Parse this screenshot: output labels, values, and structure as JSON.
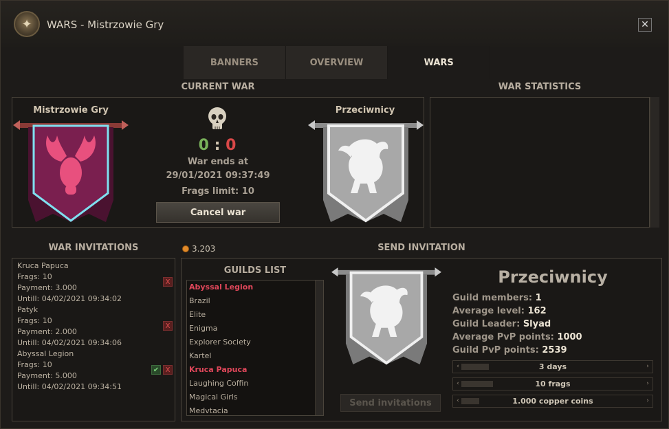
{
  "window": {
    "title": "WARS - Mistrzowie Gry",
    "close": "✕"
  },
  "tabs": [
    {
      "label": "BANNERS"
    },
    {
      "label": "OVERVIEW"
    },
    {
      "label": "WARS",
      "active": true
    }
  ],
  "current_war": {
    "header": "CURRENT WAR",
    "own_guild": "Mistrzowie Gry",
    "enemy_guild": "Przeciwnicy",
    "score_own": "0",
    "score_sep": ":",
    "score_enemy": "0",
    "ends_label": "War ends at",
    "ends_at": "29/01/2021 09:37:49",
    "frags_limit": "Frags limit: 10",
    "cancel_label": "Cancel war"
  },
  "war_statistics": {
    "header": "WAR STATISTICS"
  },
  "war_invitations": {
    "header": "WAR INVITATIONS",
    "items": [
      {
        "name": "Kruca Papuca",
        "frags": "Frags: 10",
        "payment": "Payment: 3.000",
        "until": "Untill: 04/02/2021 09:34:02",
        "accept": false
      },
      {
        "name": "Patyk",
        "frags": "Frags: 10",
        "payment": "Payment: 2.000",
        "until": "Untill: 04/02/2021 09:34:06",
        "accept": false
      },
      {
        "name": "Abyssal Legion",
        "frags": "Frags: 10",
        "payment": "Payment: 5.000",
        "until": "Untill: 04/02/2021 09:34:51",
        "accept": true
      }
    ],
    "reject_glyph": "X",
    "accept_glyph": "✔"
  },
  "currency": {
    "value": "3.203"
  },
  "send_invitation": {
    "header": "SEND INVITATION",
    "guilds_list_header": "GUILDS LIST",
    "guilds": [
      {
        "name": "Abyssal Legion",
        "highlight": true
      },
      {
        "name": "Brazil",
        "highlight": false
      },
      {
        "name": "Elite",
        "highlight": false
      },
      {
        "name": "Enigma",
        "highlight": false
      },
      {
        "name": "Explorer Society",
        "highlight": false
      },
      {
        "name": "Kartel",
        "highlight": false
      },
      {
        "name": "Kruca Papuca",
        "highlight": true
      },
      {
        "name": "Laughing Coffin",
        "highlight": false
      },
      {
        "name": "Magical Girls",
        "highlight": false
      },
      {
        "name": "Medvtacia",
        "highlight": false
      }
    ],
    "selected_guild": "Przeciwnicy",
    "stats": [
      {
        "label": "Guild members:",
        "value": "1"
      },
      {
        "label": "Average level:",
        "value": "162"
      },
      {
        "label": "Guild Leader:",
        "value": "Slyad"
      },
      {
        "label": "Average PvP points:",
        "value": "1000"
      },
      {
        "label": "Guild PvP points:",
        "value": "2539"
      }
    ],
    "sliders": [
      {
        "label": "3 days",
        "level": 0.15
      },
      {
        "label": "10 frags",
        "level": 0.17
      },
      {
        "label": "1.000 copper coins",
        "level": 0.09
      }
    ],
    "send_label": "Send invitations"
  },
  "colors": {
    "accent_red": "#e0475a",
    "accent_green": "#78b05a",
    "own_banner": "#7a1f4f",
    "enemy_banner": "#bdbdbd"
  }
}
